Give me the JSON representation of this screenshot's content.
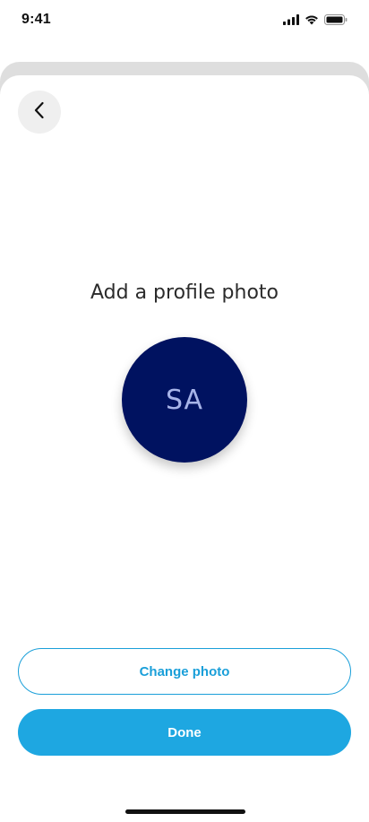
{
  "status_bar": {
    "time": "9:41",
    "icons": [
      "signal-icon",
      "wifi-icon",
      "battery-icon"
    ]
  },
  "header": {
    "back_icon": "chevron-left-icon"
  },
  "main": {
    "title": "Add a profile photo",
    "avatar_initials": "SA"
  },
  "actions": {
    "change_photo_label": "Change photo",
    "done_label": "Done"
  },
  "colors": {
    "accent": "#1EA7E1",
    "outline_text": "#1A9FD9",
    "avatar_bg": "#001260",
    "avatar_text": "#A7B4E8",
    "primary_text": "#FFFFFF"
  }
}
